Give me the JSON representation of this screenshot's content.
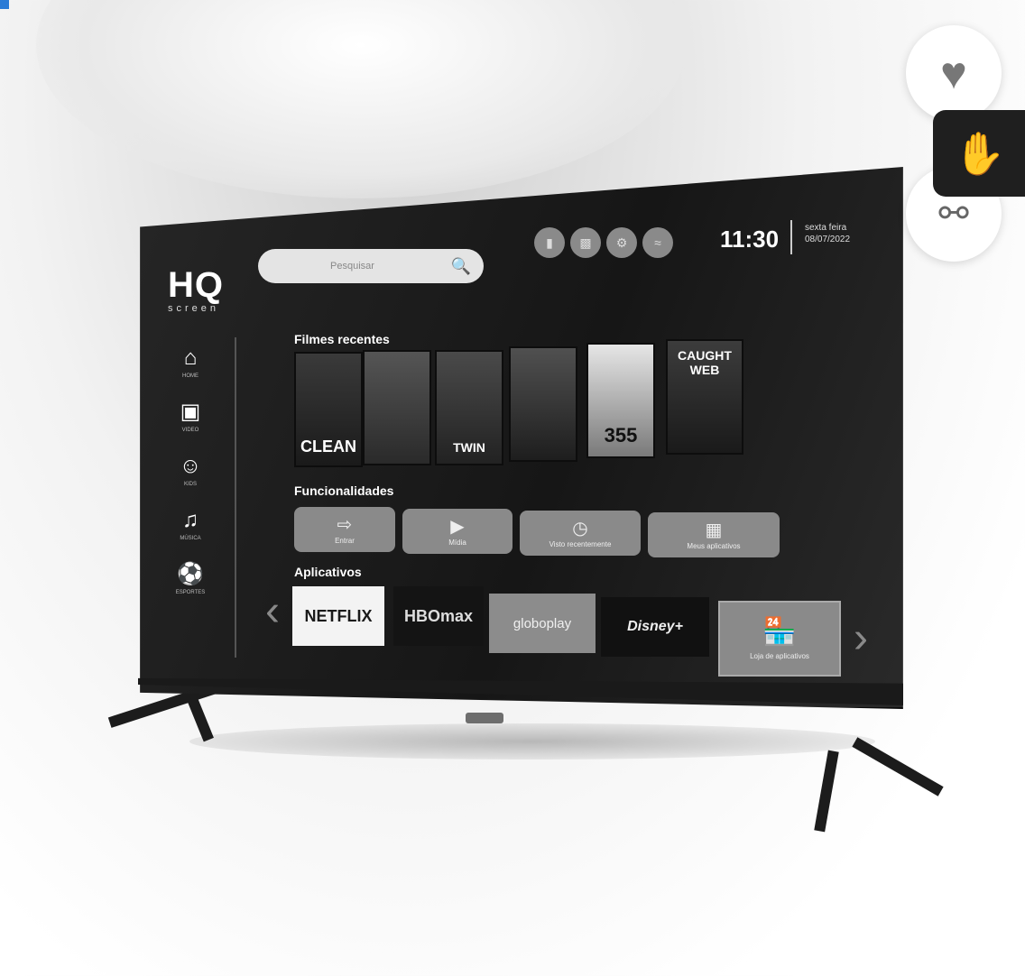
{
  "tv": {
    "brand": {
      "name": "HQ",
      "sub": "screen"
    },
    "search": {
      "placeholder": "Pesquisar"
    },
    "status_icons": [
      "usb-icon",
      "sd-card-icon",
      "settings-icon",
      "wifi-icon"
    ],
    "clock": "11:30",
    "date": {
      "weekday": "sexta feira",
      "date": "08/07/2022"
    },
    "sidebar": [
      {
        "label": "HOME",
        "icon": "home-icon"
      },
      {
        "label": "VIDEO",
        "icon": "video-camera-icon"
      },
      {
        "label": "KIDS",
        "icon": "kids-face-icon"
      },
      {
        "label": "MÚSICA",
        "icon": "music-note-icon"
      },
      {
        "label": "ESPORTES",
        "icon": "soccer-ball-icon"
      }
    ],
    "sections": {
      "recent": "Filmes recentes",
      "features": "Funcionalidades",
      "apps": "Aplicativos"
    },
    "posters": [
      {
        "title": "CLEAN"
      },
      {
        "title": ""
      },
      {
        "title": "TWIN"
      },
      {
        "title": ""
      },
      {
        "title": "355"
      },
      {
        "title": "CAUGHT WEB"
      }
    ],
    "features": [
      {
        "label": "Entrar",
        "icon": "input-icon"
      },
      {
        "label": "Mídia",
        "icon": "media-play-icon"
      },
      {
        "label": "Visto recentemente",
        "icon": "clock-history-icon"
      },
      {
        "label": "Meus aplicativos",
        "icon": "apps-grid-icon"
      }
    ],
    "apps": [
      {
        "label": "NETFLIX"
      },
      {
        "label": "HBOmax"
      },
      {
        "label": "globoplay"
      },
      {
        "label": "Disney+"
      },
      {
        "label": "Loja de aplicativos",
        "icon": "store-icon"
      }
    ]
  },
  "floating": {
    "favorite_icon": "heart-icon",
    "accessibility_icon": "sign-language-hands-icon",
    "share_icon": "share-icon"
  }
}
